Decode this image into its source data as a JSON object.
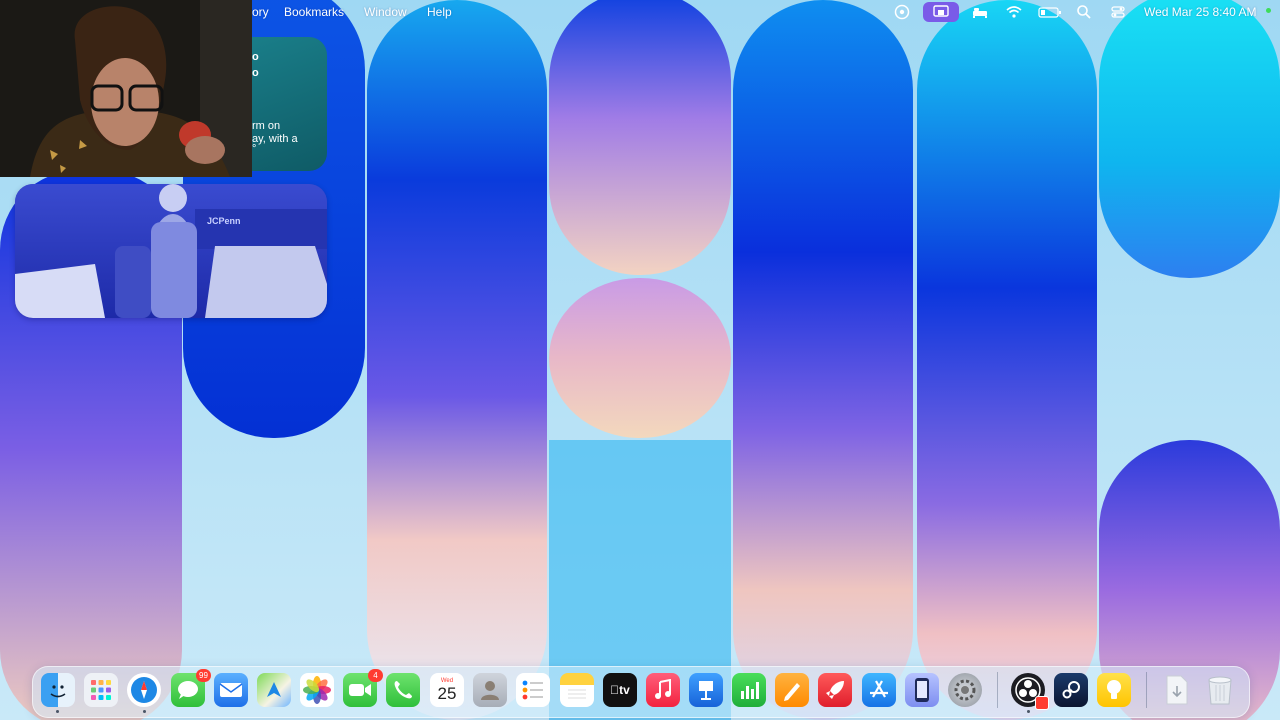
{
  "menubar": {
    "items": [
      "ory",
      "Bookmarks",
      "Window",
      "Help"
    ],
    "clock": "Wed Mar 25  8:40 AM",
    "status_icons": [
      "obs-recording-icon",
      "screen-mirroring-icon",
      "sleep-icon",
      "wifi-icon",
      "battery-icon",
      "search-icon",
      "control-center-icon"
    ]
  },
  "widgets": {
    "note": {
      "lines": [
        "o",
        "o",
        "rm on",
        "ay, with a",
        "°"
      ]
    },
    "photo": {
      "sign": "JCPenn"
    }
  },
  "dock": {
    "apps": [
      {
        "name": "Finder",
        "icon": "finder-icon",
        "running": true
      },
      {
        "name": "Launchpad",
        "icon": "launchpad-icon"
      },
      {
        "name": "Safari",
        "icon": "safari-icon",
        "running": true
      },
      {
        "name": "Messages",
        "icon": "messages-icon",
        "badge": "99"
      },
      {
        "name": "Mail",
        "icon": "mail-icon"
      },
      {
        "name": "Maps",
        "icon": "maps-icon"
      },
      {
        "name": "Photos",
        "icon": "photos-icon"
      },
      {
        "name": "FaceTime",
        "icon": "facetime-icon",
        "badge": "4"
      },
      {
        "name": "Phone",
        "icon": "phone-icon"
      },
      {
        "name": "Calendar",
        "icon": "calendar-icon",
        "month": "Wed",
        "day": "25"
      },
      {
        "name": "Contacts",
        "icon": "contacts-icon"
      },
      {
        "name": "Reminders",
        "icon": "reminders-icon"
      },
      {
        "name": "Notes",
        "icon": "notes-icon"
      },
      {
        "name": "TV",
        "icon": "appletv-icon",
        "label": "tv"
      },
      {
        "name": "Music",
        "icon": "music-icon"
      },
      {
        "name": "Keynote",
        "icon": "keynote-icon"
      },
      {
        "name": "Numbers",
        "icon": "numbers-icon"
      },
      {
        "name": "Pages",
        "icon": "pages-icon"
      },
      {
        "name": "Rocket",
        "icon": "rocket-icon"
      },
      {
        "name": "App Store",
        "icon": "appstore-icon"
      },
      {
        "name": "Simulator",
        "icon": "simulator-icon"
      },
      {
        "name": "System Settings",
        "icon": "settings-icon"
      },
      {
        "name": "OBS",
        "icon": "obs-icon",
        "running": true
      },
      {
        "name": "Steam",
        "icon": "steam-icon"
      },
      {
        "name": "Tips",
        "icon": "tips-icon"
      },
      {
        "name": "Downloads",
        "icon": "downloads-icon"
      },
      {
        "name": "Trash",
        "icon": "trash-icon"
      }
    ]
  }
}
